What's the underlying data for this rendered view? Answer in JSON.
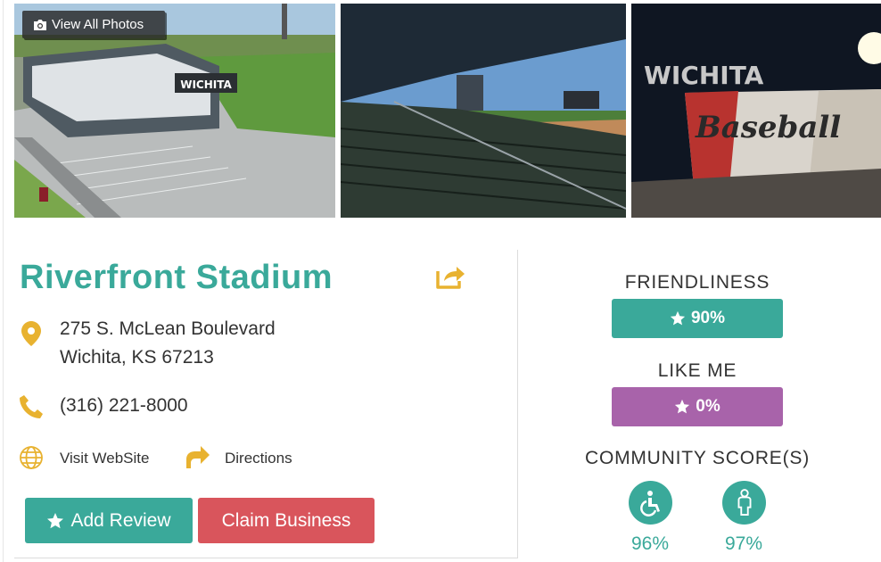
{
  "gallery": {
    "view_all_label": "View All Photos",
    "photos": [
      {
        "sign_text": "WICHITA"
      },
      {
        "sign_text": ""
      },
      {
        "sign_text": "WICHITA",
        "mural_text": "Baseball"
      }
    ]
  },
  "business": {
    "name": "Riverfront Stadium",
    "address_line1": "275 S. McLean Boulevard",
    "address_line2": "Wichita, KS 67213",
    "phone": "(316) 221-8000",
    "website_label": "Visit WebSite",
    "directions_label": "Directions"
  },
  "actions": {
    "add_review_label": "Add Review",
    "claim_business_label": "Claim Business"
  },
  "scores": {
    "friendliness_label": "FRIENDLINESS",
    "friendliness_value": "90%",
    "like_me_label": "LIKE ME",
    "like_me_value": "0%",
    "community_label": "COMMUNITY SCORE(S)",
    "community": [
      {
        "icon": "wheelchair-icon",
        "value": "96%"
      },
      {
        "icon": "person-icon",
        "value": "97%"
      }
    ]
  },
  "colors": {
    "teal": "#3aa99a",
    "purple": "#a863aa",
    "red": "#d9555c",
    "gold": "#e8b230"
  }
}
